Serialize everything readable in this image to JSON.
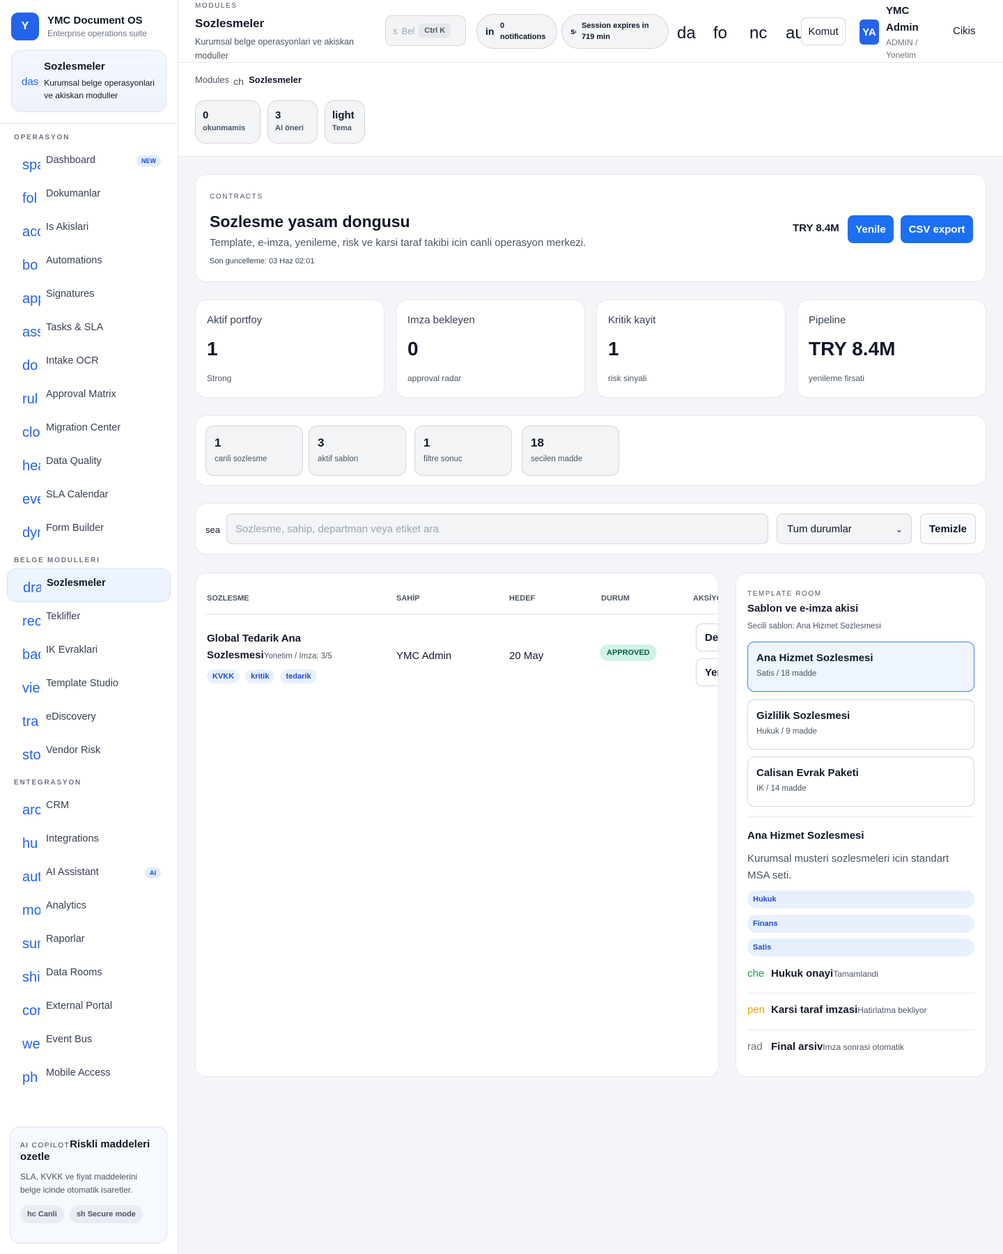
{
  "sidebar": {
    "brand": {
      "logo": "Y",
      "title": "YMC Document OS",
      "subtitle": "Enterprise operations suite"
    },
    "context": {
      "icon": "das",
      "title": "Sozlesmeler",
      "subtitle": "Kurumsal belge operasyonlari ve akiskan moduller"
    },
    "sections": [
      {
        "title": "OPERASYON",
        "items": [
          {
            "icon": "spa",
            "label": "Dashboard",
            "badge": "NEW"
          },
          {
            "icon": "fol",
            "label": "Dokumanlar"
          },
          {
            "icon": "acc",
            "label": "Is Akislari"
          },
          {
            "icon": "bo",
            "label": "Automations"
          },
          {
            "icon": "app",
            "label": "Signatures"
          },
          {
            "icon": "ass",
            "label": "Tasks & SLA"
          },
          {
            "icon": "do",
            "label": "Intake OCR"
          },
          {
            "icon": "rul",
            "label": "Approval Matrix"
          },
          {
            "icon": "clo",
            "label": "Migration Center"
          },
          {
            "icon": "hea",
            "label": "Data Quality"
          },
          {
            "icon": "eve",
            "label": "SLA Calendar"
          },
          {
            "icon": "dyn",
            "label": "Form Builder"
          }
        ]
      },
      {
        "title": "BELGE MODULLERI",
        "items": [
          {
            "icon": "dra",
            "label": "Sozlesmeler",
            "active": true
          },
          {
            "icon": "rec",
            "label": "Teklifler"
          },
          {
            "icon": "bad",
            "label": "IK Evraklari"
          },
          {
            "icon": "vie",
            "label": "Template Studio"
          },
          {
            "icon": "tra",
            "label": "eDiscovery"
          },
          {
            "icon": "sto",
            "label": "Vendor Risk"
          }
        ]
      },
      {
        "title": "ENTEGRASYON",
        "items": [
          {
            "icon": "arc",
            "label": "CRM"
          },
          {
            "icon": "hu",
            "label": "Integrations"
          },
          {
            "icon": "aut",
            "label": "AI Assistant",
            "badge": "AI"
          },
          {
            "icon": "mo",
            "label": "Analytics"
          },
          {
            "icon": "sum",
            "label": "Raporlar"
          },
          {
            "icon": "shi",
            "label": "Data Rooms"
          },
          {
            "icon": "con",
            "label": "External Portal"
          },
          {
            "icon": "we",
            "label": "Event Bus"
          },
          {
            "icon": "ph",
            "label": "Mobile Access"
          }
        ]
      }
    ],
    "copilot": {
      "kicker": "AI COPİLOT",
      "title": "Riskli maddeleri ozetle",
      "text": "SLA, KVKK ve fiyat maddelerini belge icinde otomatik isaretler.",
      "pills": [
        {
          "icon": "hc",
          "label": "Canli"
        },
        {
          "icon": "sh",
          "label": "Secure mode"
        }
      ]
    }
  },
  "topbar": {
    "kicker": "MODULES",
    "title": "Sozlesmeler",
    "subtitle": "Kurumsal belge operasyonlari ve akiskan moduller",
    "search": {
      "icon": "s",
      "placeholder": "Bel",
      "shortcut": "Ctrl K"
    },
    "notifications": {
      "icon": "in",
      "text": "0 notifications"
    },
    "session": {
      "icon": "sc",
      "text": "Session expires in 719 min"
    },
    "icon_buttons": [
      "da",
      "fo",
      "nc",
      "au"
    ],
    "command_label": "Komut",
    "user": {
      "initials": "YA",
      "name": "YMC Admin",
      "role": "ADMIN / Yonetim"
    },
    "logout_label": "Cikis"
  },
  "breadcrumb": {
    "root": "Modules",
    "sep": "ch",
    "current": "Sozlesmeler"
  },
  "mini_stats": [
    {
      "value": "0",
      "label": "okunmamis"
    },
    {
      "value": "3",
      "label": "AI öneri"
    },
    {
      "value": "light",
      "label": "Tema"
    }
  ],
  "hero": {
    "kicker": "CONTRACTS",
    "title": "Sozlesme yasam dongusu",
    "subtitle": "Template, e-imza, yenileme, risk ve karsi taraf takibi icin canli operasyon merkezi.",
    "updated": "Son guncelleme: 03 Haz 02:01",
    "amount": "TRY 8.4M",
    "refresh_label": "Yenile",
    "export_label": "CSV export"
  },
  "kpis": [
    {
      "label": "Aktif portfoy",
      "value": "1",
      "sub": "Strong"
    },
    {
      "label": "Imza bekleyen",
      "value": "0",
      "sub": "approval radar"
    },
    {
      "label": "Kritik kayit",
      "value": "1",
      "sub": "risk sinyali"
    },
    {
      "label": "Pipeline",
      "value": "TRY 8.4M",
      "sub": "yenileme firsati"
    }
  ],
  "stats": [
    {
      "value": "1",
      "label": "canli sozlesme"
    },
    {
      "value": "3",
      "label": "aktif sablon"
    },
    {
      "value": "1",
      "label": "filtre sonuc"
    },
    {
      "value": "18",
      "label": "secilen madde"
    }
  ],
  "filter": {
    "icon": "sea",
    "placeholder": "Sozlesme, sahip, departman veya etiket ara",
    "status_value": "Tum durumlar",
    "clear_label": "Temizle"
  },
  "table": {
    "headers": [
      "SOZLESME",
      "SAHİP",
      "HEDEF",
      "DURUM",
      "AKSİYON"
    ],
    "rows": [
      {
        "name_line1": "Global Tedarik Ana",
        "name_line2": "Sozlesmesi",
        "meta": "Yonetim / Imza: 3/5",
        "tags": [
          "KVKK",
          "kritik",
          "tedarik"
        ],
        "owner": "YMC Admin",
        "target": "20 May",
        "status": "APPROVED",
        "actions": [
          "Detay",
          "Yenile"
        ]
      }
    ]
  },
  "template_room": {
    "kicker": "TEMPLATE ROOM",
    "title": "Sablon ve e-imza akisi",
    "selected": "Secili sablon: Ana Hizmet Sozlesmesi",
    "templates": [
      {
        "name": "Ana Hizmet Sozlesmesi",
        "meta": "Satis / 18 madde",
        "selected": true
      },
      {
        "name": "Gizlilik Sozlesmesi",
        "meta": "Hukuk / 9 madde"
      },
      {
        "name": "Calisan Evrak Paketi",
        "meta": "IK / 14 madde"
      }
    ],
    "detail_title": "Ana Hizmet Sozlesmesi",
    "detail_desc": "Kurumsal musteri sozlesmeleri icin standart MSA seti.",
    "departments": [
      "Hukuk",
      "Finans",
      "Satis"
    ],
    "steps": [
      {
        "icon": "che",
        "color": "#16a34a",
        "title": "Hukuk onayi",
        "status": "Tamamlandi"
      },
      {
        "icon": "pen",
        "color": "#f59e0b",
        "title": "Karsi taraf imzasi",
        "status": "Hatirlatma bekliyor"
      },
      {
        "icon": "rad",
        "color": "#6b7280",
        "title": "Final arsiv",
        "status": "Imza sonrasi otomatik"
      }
    ]
  }
}
